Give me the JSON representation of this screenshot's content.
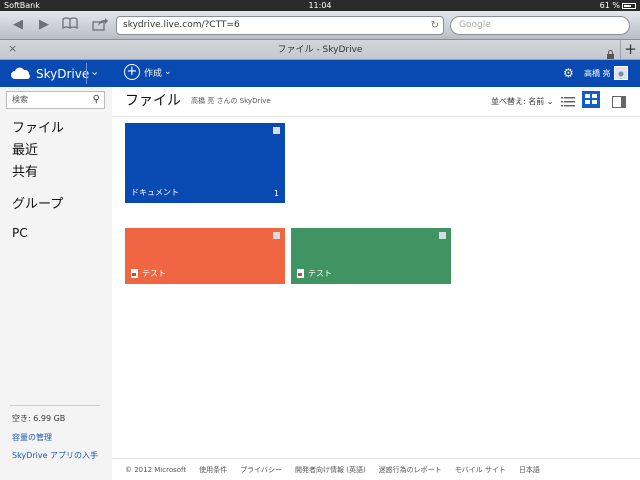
{
  "status_bar": {
    "carrier": "SoftBank",
    "time": "11:04",
    "battery": "61 %"
  },
  "browser": {
    "url": "skydrive.live.com/?CTT=6",
    "search_placeholder": "Google",
    "tab_title": "ファイル - SkyDrive"
  },
  "header": {
    "brand": "SkyDrive",
    "create_label": "作成",
    "user_name": "高橋 亮"
  },
  "sidebar": {
    "search_label": "検索",
    "nav": [
      "ファイル",
      "最近",
      "共有",
      "グループ",
      "PC"
    ],
    "quota": "空き: 6.99 GB",
    "manage_storage": "容量の管理",
    "get_app": "SkyDrive アプリの入手"
  },
  "main": {
    "title": "ファイル",
    "subtitle": "高橋 亮 さんの SkyDrive",
    "sort_label": "並べ替え: 名前"
  },
  "tiles": [
    {
      "label": "ドキュメント",
      "count": "1",
      "color": "#094ab2"
    },
    {
      "label": "テスト",
      "color": "#f06542"
    },
    {
      "label": "テスト",
      "color": "#3f9461"
    }
  ],
  "footer": [
    "© 2012 Microsoft",
    "使用条件",
    "プライバシー",
    "開発者向け情報 (英語)",
    "迷惑行為のレポート",
    "モバイル サイト",
    "日本語"
  ]
}
